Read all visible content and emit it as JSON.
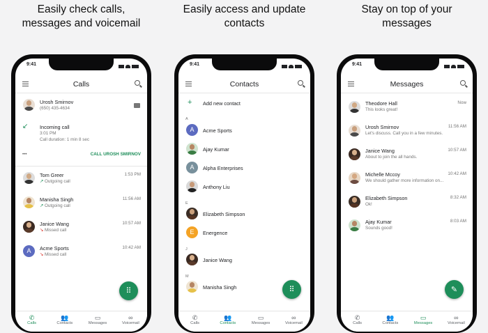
{
  "panels": [
    {
      "headline": [
        "Easily check calls,",
        "messages and voicemail"
      ],
      "status_time": "9:41",
      "title": "Calls",
      "featured": {
        "name": "Urosh Smirnov",
        "phone": "(650) 435-4634"
      },
      "incoming": {
        "title": "Incoming call",
        "time": "3:01 PM",
        "duration": "Call duration: 1 min 8 sec",
        "action": "CALL UROSH SMIRNOV",
        "more": "•••"
      },
      "calls": [
        {
          "name": "Tom Greer",
          "status": "Outgoing call",
          "time": "1:53 PM",
          "arrow": "↗",
          "missed": false
        },
        {
          "name": "Manisha Singh",
          "status": "Outgoing call",
          "time": "11:56 AM",
          "arrow": "↗",
          "missed": false
        },
        {
          "name": "Janice Wang",
          "status": "Missed call",
          "time": "10:57 AM",
          "arrow": "↘",
          "missed": true
        },
        {
          "name": "Acme Sports",
          "status": "Missed call",
          "time": "10:42 AM",
          "arrow": "↘",
          "missed": true,
          "letter": "A"
        }
      ]
    },
    {
      "headline": [
        "Easily access and update",
        "contacts"
      ],
      "status_time": "9:41",
      "title": "Contacts",
      "add_label": "Add new contact",
      "sections": {
        "a": "A",
        "e": "E",
        "j": "J",
        "m": "M"
      },
      "contacts": [
        {
          "name": "Acme Sports",
          "letter": "A"
        },
        {
          "name": "Ajay Kumar"
        },
        {
          "name": "Alpha Enterprises",
          "letter": "A"
        },
        {
          "name": "Anthony Liu"
        },
        {
          "name": "Elizabeth Simpson"
        },
        {
          "name": "Energence",
          "letter": "E"
        },
        {
          "name": "Janice Wang"
        },
        {
          "name": "Manisha Singh"
        }
      ]
    },
    {
      "headline": [
        "Stay on top of your",
        "messages"
      ],
      "status_time": "9:41",
      "title": "Messages",
      "messages": [
        {
          "name": "Theodore Hall",
          "preview": "This looks great!",
          "time": "Now"
        },
        {
          "name": "Urosh Smirnov",
          "preview": "Let's discuss. Call you in a few minutes.",
          "time": "11:56 AM"
        },
        {
          "name": "Janice Wang",
          "preview": "About to join the all hands.",
          "time": "10:57 AM"
        },
        {
          "name": "Michelle Mccoy",
          "preview": "We should gather more information on...",
          "time": "10:42 AM"
        },
        {
          "name": "Elizabeth Simpson",
          "preview": "Ok!",
          "time": "8:32 AM"
        },
        {
          "name": "Ajay Kumar",
          "preview": "Sounds good!",
          "time": "8:03 AM"
        }
      ]
    }
  ],
  "nav": {
    "calls": "Calls",
    "contacts": "Contacts",
    "messages": "Messages",
    "voicemail": "Voicemail"
  },
  "colors": {
    "accent": "#1e8e5a",
    "letter_avatar": "#5c6bc0",
    "letter_avatar_orange": "#f4a325",
    "letter_avatar_gray": "#78909c",
    "missed": "#d93025"
  }
}
